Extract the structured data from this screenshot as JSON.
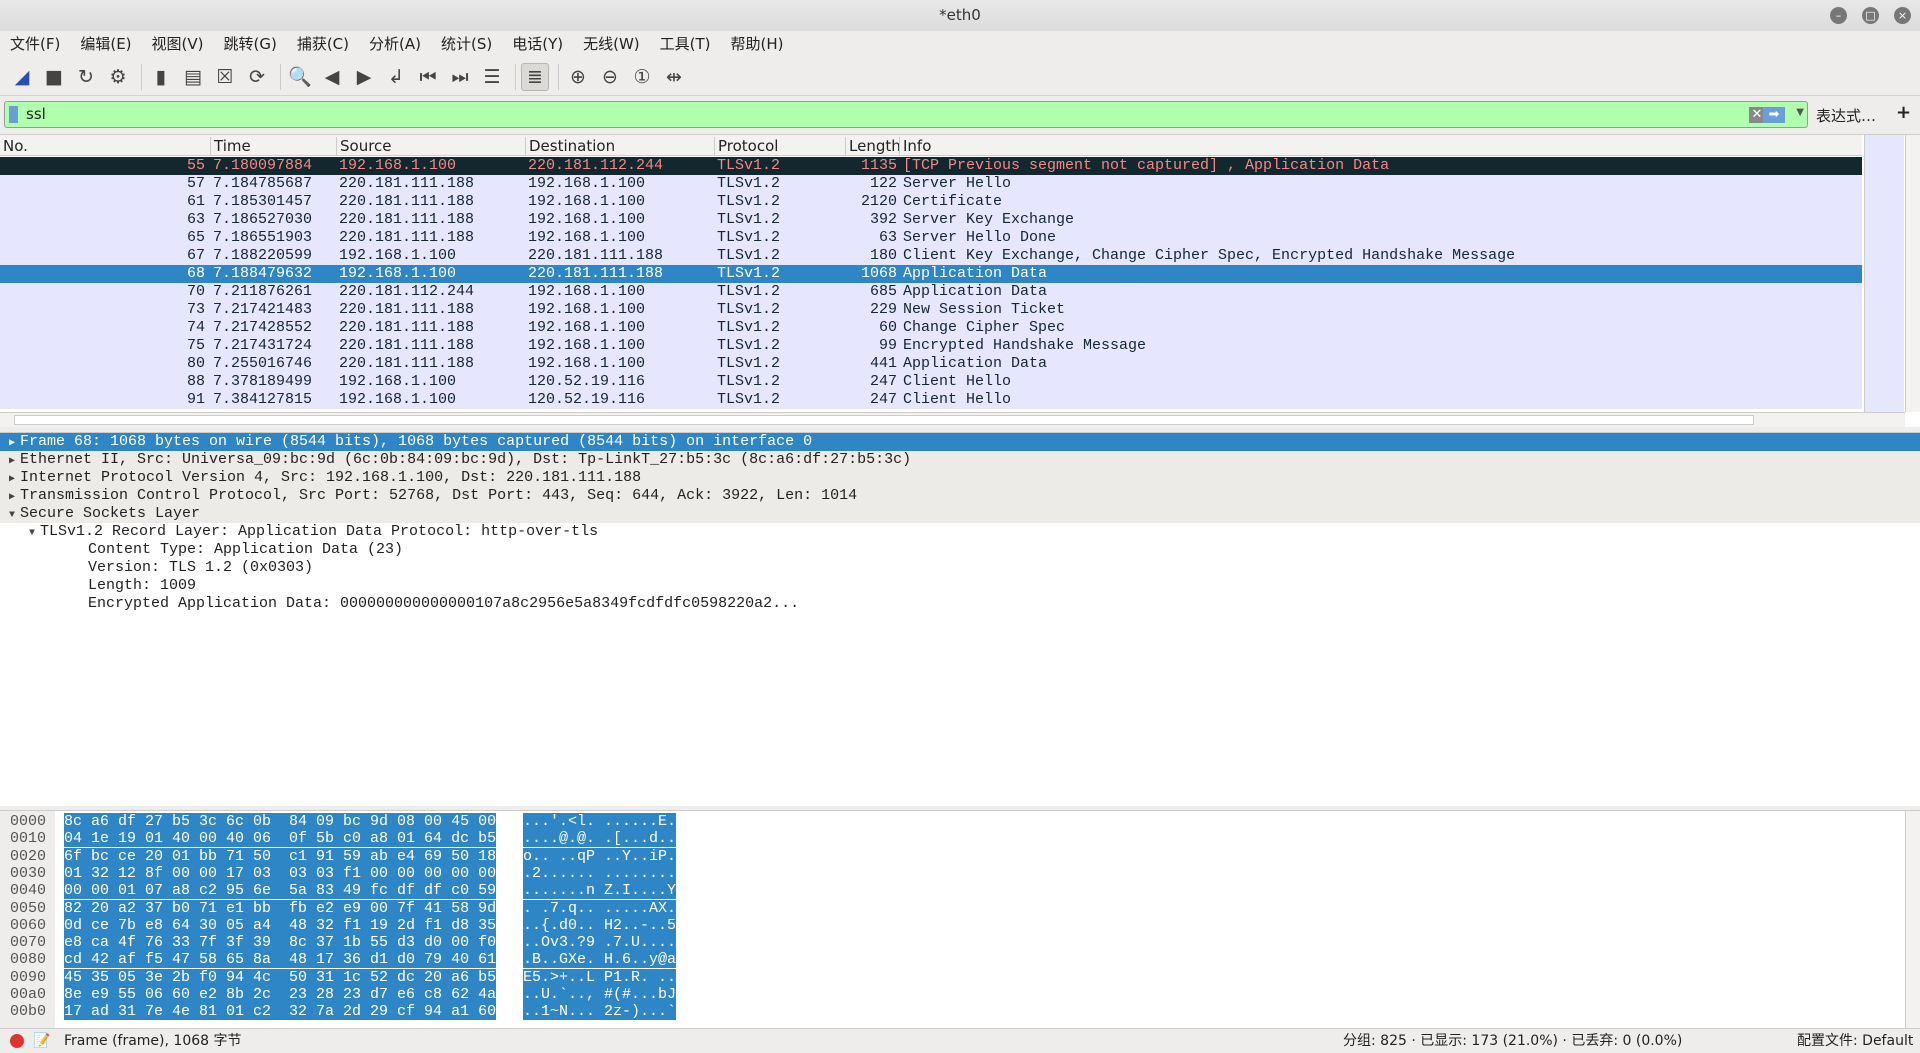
{
  "window": {
    "title": "*eth0"
  },
  "menu": [
    "文件(F)",
    "编辑(E)",
    "视图(V)",
    "跳转(G)",
    "捕获(C)",
    "分析(A)",
    "统计(S)",
    "电话(Y)",
    "无线(W)",
    "工具(T)",
    "帮助(H)"
  ],
  "toolbar": [
    "start-capture-icon",
    "stop-capture-icon",
    "restart-capture-icon",
    "capture-options-icon",
    "open-file-icon",
    "save-file-icon",
    "close-file-icon",
    "reload-file-icon",
    "find-packet-icon",
    "go-back-icon",
    "go-forward-icon",
    "go-to-packet-icon",
    "first-packet-icon",
    "last-packet-icon",
    "autoscroll-icon",
    "colorize-icon",
    "zoom-in-icon",
    "zoom-out-icon",
    "zoom-normal-icon",
    "resize-columns-icon"
  ],
  "filter": {
    "value": "ssl",
    "expression_label": "表达式…",
    "add_label": "+"
  },
  "columns": [
    "No.",
    "Time",
    "Source",
    "Destination",
    "Protocol",
    "Length",
    "Info"
  ],
  "packets": [
    {
      "no": "55",
      "time": "7.180097884",
      "src": "192.168.1.100",
      "dst": "220.181.112.244",
      "proto": "TLSv1.2",
      "len": "1135",
      "info": "[TCP Previous segment not captured] , Application Data",
      "state": "marked"
    },
    {
      "no": "57",
      "time": "7.184785687",
      "src": "220.181.111.188",
      "dst": "192.168.1.100",
      "proto": "TLSv1.2",
      "len": "122",
      "info": "Server Hello"
    },
    {
      "no": "61",
      "time": "7.185301457",
      "src": "220.181.111.188",
      "dst": "192.168.1.100",
      "proto": "TLSv1.2",
      "len": "2120",
      "info": "Certificate"
    },
    {
      "no": "63",
      "time": "7.186527030",
      "src": "220.181.111.188",
      "dst": "192.168.1.100",
      "proto": "TLSv1.2",
      "len": "392",
      "info": "Server Key Exchange"
    },
    {
      "no": "65",
      "time": "7.186551903",
      "src": "220.181.111.188",
      "dst": "192.168.1.100",
      "proto": "TLSv1.2",
      "len": "63",
      "info": "Server Hello Done"
    },
    {
      "no": "67",
      "time": "7.188220599",
      "src": "192.168.1.100",
      "dst": "220.181.111.188",
      "proto": "TLSv1.2",
      "len": "180",
      "info": "Client Key Exchange, Change Cipher Spec, Encrypted Handshake Message"
    },
    {
      "no": "68",
      "time": "7.188479632",
      "src": "192.168.1.100",
      "dst": "220.181.111.188",
      "proto": "TLSv1.2",
      "len": "1068",
      "info": "Application Data",
      "state": "selected"
    },
    {
      "no": "70",
      "time": "7.211876261",
      "src": "220.181.112.244",
      "dst": "192.168.1.100",
      "proto": "TLSv1.2",
      "len": "685",
      "info": "Application Data"
    },
    {
      "no": "73",
      "time": "7.217421483",
      "src": "220.181.111.188",
      "dst": "192.168.1.100",
      "proto": "TLSv1.2",
      "len": "229",
      "info": "New Session Ticket"
    },
    {
      "no": "74",
      "time": "7.217428552",
      "src": "220.181.111.188",
      "dst": "192.168.1.100",
      "proto": "TLSv1.2",
      "len": "60",
      "info": "Change Cipher Spec"
    },
    {
      "no": "75",
      "time": "7.217431724",
      "src": "220.181.111.188",
      "dst": "192.168.1.100",
      "proto": "TLSv1.2",
      "len": "99",
      "info": "Encrypted Handshake Message"
    },
    {
      "no": "80",
      "time": "7.255016746",
      "src": "220.181.111.188",
      "dst": "192.168.1.100",
      "proto": "TLSv1.2",
      "len": "441",
      "info": "Application Data"
    },
    {
      "no": "88",
      "time": "7.378189499",
      "src": "192.168.1.100",
      "dst": "120.52.19.116",
      "proto": "TLSv1.2",
      "len": "247",
      "info": "Client Hello"
    },
    {
      "no": "91",
      "time": "7.384127815",
      "src": "192.168.1.100",
      "dst": "120.52.19.116",
      "proto": "TLSv1.2",
      "len": "247",
      "info": "Client Hello"
    }
  ],
  "details": [
    {
      "text": "Frame 68: 1068 bytes on wire (8544 bits), 1068 bytes captured (8544 bits) on interface 0",
      "level": 0,
      "expand": "collapsed",
      "state": "selected"
    },
    {
      "text": "Ethernet II, Src: Universa_09:bc:9d (6c:0b:84:09:bc:9d), Dst: Tp-LinkT_27:b5:3c (8c:a6:df:27:b5:3c)",
      "level": 0,
      "expand": "collapsed"
    },
    {
      "text": "Internet Protocol Version 4, Src: 192.168.1.100, Dst: 220.181.111.188",
      "level": 0,
      "expand": "collapsed"
    },
    {
      "text": "Transmission Control Protocol, Src Port: 52768, Dst Port: 443, Seq: 644, Ack: 3922, Len: 1014",
      "level": 0,
      "expand": "collapsed"
    },
    {
      "text": "Secure Sockets Layer",
      "level": 0,
      "expand": "expanded"
    },
    {
      "text": "TLSv1.2 Record Layer: Application Data Protocol: http-over-tls",
      "level": 1,
      "expand": "expanded"
    },
    {
      "text": "Content Type: Application Data (23)",
      "level": 2
    },
    {
      "text": "Version: TLS 1.2 (0x0303)",
      "level": 2
    },
    {
      "text": "Length: 1009",
      "level": 2
    },
    {
      "text": "Encrypted Application Data: 000000000000000107a8c2956e5a8349fcdfdfc0598220a2...",
      "level": 2
    }
  ],
  "hex": [
    {
      "off": "0000",
      "hex": "8c a6 df 27 b5 3c 6c 0b  84 09 bc 9d 08 00 45 00",
      "ascii": "...'.<l. ......E."
    },
    {
      "off": "0010",
      "hex": "04 1e 19 01 40 00 40 06  0f 5b c0 a8 01 64 dc b5",
      "ascii": "....@.@. .[...d.."
    },
    {
      "off": "0020",
      "hex": "6f bc ce 20 01 bb 71 50  c1 91 59 ab e4 69 50 18",
      "ascii": "o.. ..qP ..Y..iP."
    },
    {
      "off": "0030",
      "hex": "01 32 12 8f 00 00 17 03  03 03 f1 00 00 00 00 00",
      "ascii": ".2...... ........"
    },
    {
      "off": "0040",
      "hex": "00 00 01 07 a8 c2 95 6e  5a 83 49 fc df df c0 59",
      "ascii": ".......n Z.I....Y"
    },
    {
      "off": "0050",
      "hex": "82 20 a2 37 b0 71 e1 bb  fb e2 e9 00 7f 41 58 9d",
      "ascii": ". .7.q.. .....AX."
    },
    {
      "off": "0060",
      "hex": "0d ce 7b e8 64 30 05 a4  48 32 f1 19 2d f1 d8 35",
      "ascii": "..{.d0.. H2..-..5"
    },
    {
      "off": "0070",
      "hex": "e8 ca 4f 76 33 7f 3f 39  8c 37 1b 55 d3 d0 00 f0",
      "ascii": "..Ov3.?9 .7.U...."
    },
    {
      "off": "0080",
      "hex": "cd 42 af f5 47 58 65 8a  48 17 36 d1 d0 79 40 61",
      "ascii": ".B..GXe. H.6..y@a"
    },
    {
      "off": "0090",
      "hex": "45 35 05 3e 2b f0 94 4c  50 31 1c 52 dc 20 a6 b5",
      "ascii": "E5.>+..L P1.R. .."
    },
    {
      "off": "00a0",
      "hex": "8e e9 55 06 60 e2 8b 2c  23 28 23 d7 e6 c8 62 4a",
      "ascii": "..U.`.., #(#...bJ"
    },
    {
      "off": "00b0",
      "hex": "17 ad 31 7e 4e 81 01 c2  32 7a 2d 29 cf 94 a1 60",
      "ascii": "..1~N... 2z-)...`"
    }
  ],
  "status": {
    "field": "Frame (frame), 1068 字节",
    "counts": "分组: 825 · 已显示: 173 (21.0%) · 已丢弃: 0 (0.0%)",
    "profile": "配置文件: Default"
  },
  "colors": {
    "row_default": "#e7e6ff",
    "row_marked_bg": "#12272e",
    "row_marked_fg": "#f78787",
    "selected": "#2f86c6",
    "filter_valid": "#afffaf"
  }
}
